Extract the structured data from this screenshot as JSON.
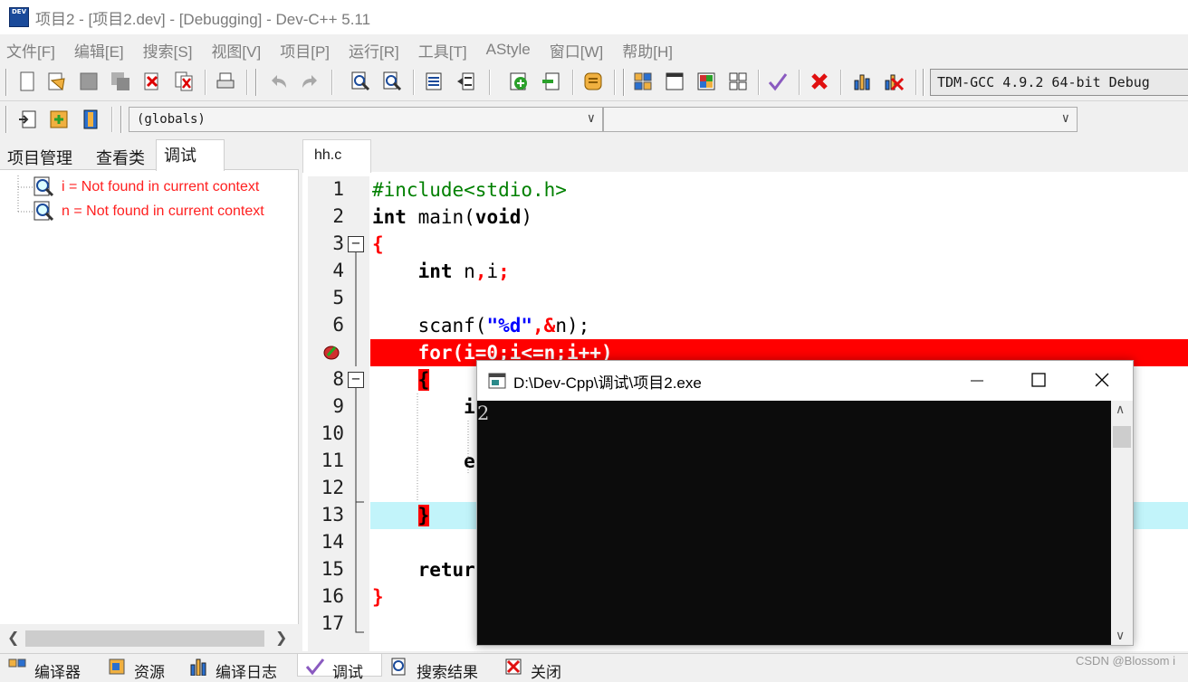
{
  "window": {
    "title": "项目2 - [项目2.dev] - [Debugging] - Dev-C++ 5.11",
    "app_icon_text": "DEV"
  },
  "menu": [
    "文件[F]",
    "编辑[E]",
    "搜索[S]",
    "视图[V]",
    "项目[P]",
    "运行[R]",
    "工具[T]",
    "AStyle",
    "窗口[W]",
    "帮助[H]"
  ],
  "toolbar": {
    "compiler": "TDM-GCC 4.9.2 64-bit Debug",
    "scope": "(globals)",
    "function": ""
  },
  "left_panel": {
    "tabs": [
      "项目管理",
      "查看类",
      "调试"
    ],
    "active_tab": "调试",
    "watches": [
      "i = Not found in current context",
      "n = Not found in current context"
    ]
  },
  "editor": {
    "file_tab": "hh.c",
    "line_numbers": [
      "1",
      "2",
      "3",
      "4",
      "5",
      "6",
      "",
      "8",
      "9",
      "10",
      "11",
      "12",
      "13",
      "14",
      "15",
      "16",
      "17"
    ],
    "lines": {
      "l1": "#include<stdio.h>",
      "l2_kw1": "int",
      "l2_fn": " main(",
      "l2_kw2": "void",
      "l2_end": ")",
      "l3": "{",
      "l4_kw": "int",
      "l4_a": " n",
      "l4_b": ",",
      "l4_c": "i",
      "l4_d": ";",
      "l6_a": "scanf(",
      "l6_str": "\"%d\"",
      "l6_b": ",",
      "l6_c": "&",
      "l6_d": "n);",
      "l7": "for(i=0;i<=n;i++)",
      "l8": "{",
      "l9": "i",
      "l11": "e",
      "l13": "}",
      "l15": "retur",
      "l16": "}"
    },
    "breakpoint_line": 7,
    "active_line": 13
  },
  "console": {
    "title": "D:\\Dev-Cpp\\调试\\项目2.exe",
    "output": "2"
  },
  "bottom_tabs": [
    "编译器",
    "资源",
    "编译日志",
    "调试",
    "搜索结果",
    "关闭"
  ],
  "bottom_active": "调试",
  "credit": "CSDN @Blossom i",
  "colors": {
    "breakpoint": "#ff0000",
    "active_line": "#c2f4fa",
    "watch_text": "#ff2020"
  }
}
